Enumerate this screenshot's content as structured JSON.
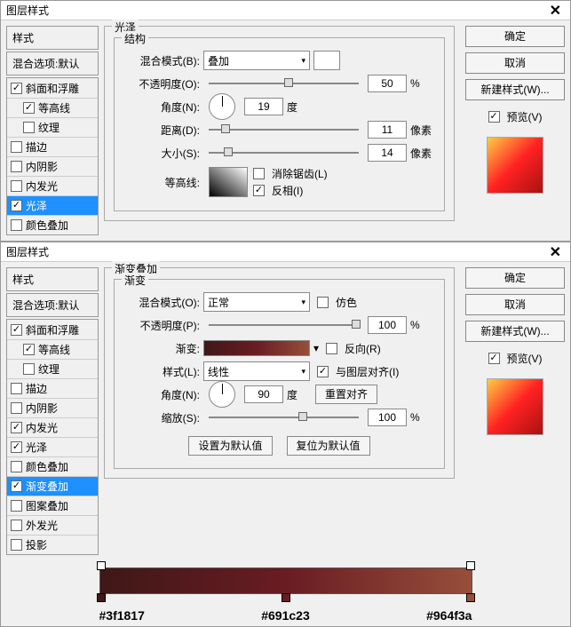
{
  "dialog1": {
    "title": "图层样式",
    "styles_header": "样式",
    "blend_header": "混合选项:默认",
    "items": [
      {
        "label": "斜面和浮雕",
        "checked": true,
        "sub": false
      },
      {
        "label": "等高线",
        "checked": true,
        "sub": true
      },
      {
        "label": "纹理",
        "checked": false,
        "sub": true
      },
      {
        "label": "描边",
        "checked": false,
        "sub": false
      },
      {
        "label": "内阴影",
        "checked": false,
        "sub": false
      },
      {
        "label": "内发光",
        "checked": false,
        "sub": false
      },
      {
        "label": "光泽",
        "checked": true,
        "sub": false,
        "selected": true
      },
      {
        "label": "颜色叠加",
        "checked": false,
        "sub": false
      }
    ],
    "main_title": "光泽",
    "group_title": "结构",
    "blend_mode_label": "混合模式(B):",
    "blend_mode_value": "叠加",
    "opacity_label": "不透明度(O):",
    "opacity_value": "50",
    "opacity_unit": "%",
    "angle_label": "角度(N):",
    "angle_value": "19",
    "angle_unit": "度",
    "distance_label": "距离(D):",
    "distance_value": "11",
    "distance_unit": "像素",
    "size_label": "大小(S):",
    "size_value": "14",
    "size_unit": "像素",
    "contour_label": "等高线:",
    "antialias_label": "消除锯齿(L)",
    "invert_label": "反相(I)",
    "ok": "确定",
    "cancel": "取消",
    "newstyle": "新建样式(W)...",
    "preview": "预览(V)"
  },
  "dialog2": {
    "title": "图层样式",
    "styles_header": "样式",
    "blend_header": "混合选项:默认",
    "items": [
      {
        "label": "斜面和浮雕",
        "checked": true,
        "sub": false
      },
      {
        "label": "等高线",
        "checked": true,
        "sub": true
      },
      {
        "label": "纹理",
        "checked": false,
        "sub": true
      },
      {
        "label": "描边",
        "checked": false,
        "sub": false
      },
      {
        "label": "内阴影",
        "checked": false,
        "sub": false
      },
      {
        "label": "内发光",
        "checked": true,
        "sub": false
      },
      {
        "label": "光泽",
        "checked": true,
        "sub": false
      },
      {
        "label": "颜色叠加",
        "checked": false,
        "sub": false
      },
      {
        "label": "渐变叠加",
        "checked": true,
        "sub": false,
        "selected": true
      },
      {
        "label": "图案叠加",
        "checked": false,
        "sub": false
      },
      {
        "label": "外发光",
        "checked": false,
        "sub": false
      },
      {
        "label": "投影",
        "checked": false,
        "sub": false
      }
    ],
    "main_title": "渐变叠加",
    "group_title": "渐变",
    "blend_mode_label": "混合模式(O):",
    "blend_mode_value": "正常",
    "dither_label": "仿色",
    "opacity_label": "不透明度(P):",
    "opacity_value": "100",
    "opacity_unit": "%",
    "gradient_label": "渐变:",
    "reverse_label": "反向(R)",
    "style_label": "样式(L):",
    "style_value": "线性",
    "align_label": "与图层对齐(I)",
    "angle_label": "角度(N):",
    "angle_value": "90",
    "angle_unit": "度",
    "reset_align": "重置对齐",
    "scale_label": "缩放(S):",
    "scale_value": "100",
    "scale_unit": "%",
    "make_default": "设置为默认值",
    "reset_default": "复位为默认值",
    "ok": "确定",
    "cancel": "取消",
    "newstyle": "新建样式(W)...",
    "preview": "预览(V)",
    "stops": {
      "c1": "#3f1817",
      "c2": "#691c23",
      "c3": "#964f3a"
    }
  }
}
